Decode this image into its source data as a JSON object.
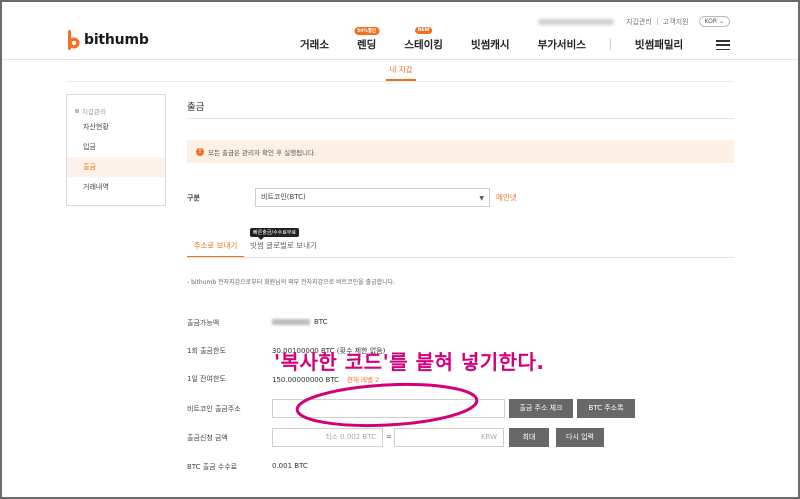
{
  "header": {
    "logo": "bithumb",
    "util_links": [
      "지갑관리",
      "고객지원"
    ],
    "lang": "KOR",
    "nav": [
      {
        "label": "거래소",
        "badge": ""
      },
      {
        "label": "렌딩",
        "badge": "50%할인"
      },
      {
        "label": "스테이킹",
        "badge": "NEW"
      },
      {
        "label": "빗썸캐시",
        "badge": ""
      },
      {
        "label": "부가서비스",
        "badge": ""
      },
      {
        "label": "빗썸패밀리",
        "badge": ""
      }
    ]
  },
  "subtab": "내 지갑",
  "sidebar": {
    "title": "지갑관리",
    "items": [
      "자산현황",
      "입금",
      "출금",
      "거래내역"
    ]
  },
  "main": {
    "title": "출금",
    "notice": "모든 출금은 관리자 확인 후 실행됩니다.",
    "coin_label": "구분",
    "coin_value": "비트코인(BTC)",
    "coin_link": "메인넷",
    "tabs": [
      "주소로 보내기",
      "빗썸 글로벌로 보내기"
    ],
    "tab_badge": "빠른출금/수수료무료",
    "description": "- bithumb 전자지갑으로부터 회원님의 외부 전자지갑으로 비트코인을 출금합니다.",
    "available_label": "출금가능액",
    "available_unit": "BTC",
    "once_label": "1회 출금한도",
    "once_value": "30.00100000 BTC (횟수 제한 없음)",
    "daily_label": "1일 잔여한도",
    "daily_value": "150.00000000 BTC",
    "daily_link": "현재 레벨 2",
    "address_label": "비트코인 출금주소",
    "btn_check": "출금 주소 체크",
    "btn_book": "BTC 주소록",
    "amount_label": "출금신청 금액",
    "amount_placeholder": "최소 0.002 BTC",
    "eq": "=",
    "krw_placeholder": "KRW",
    "btn_max": "최대",
    "btn_reset": "다시 입력",
    "fee_label": "BTC 출금 수수료",
    "fee_value": "0.001 BTC"
  },
  "annotation": "'복사한 코드'를 붙혀 넣기한다.",
  "colors": {
    "accent": "#f37021",
    "annotation": "#d4007a",
    "button": "#686868"
  }
}
